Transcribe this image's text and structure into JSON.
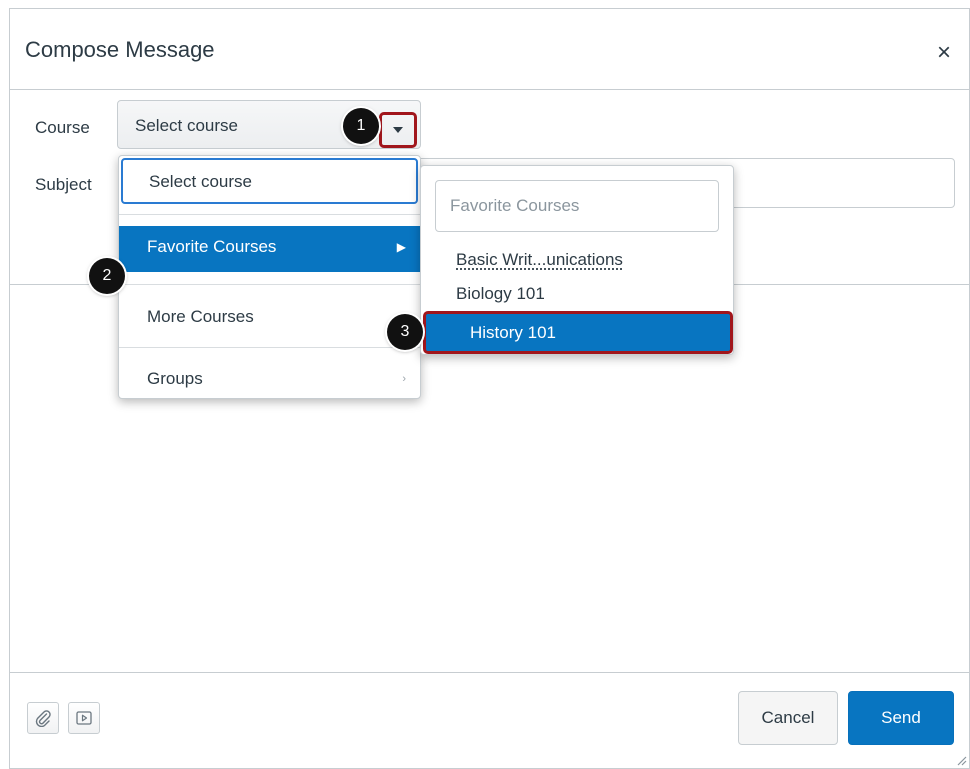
{
  "dialog": {
    "title": "Compose Message",
    "close_glyph": "×"
  },
  "fields": {
    "course_label": "Course",
    "subject_label": "Subject",
    "course_value": "Select course"
  },
  "course_menu": {
    "items": [
      {
        "label": "Select course",
        "has_submenu": false
      },
      {
        "label": "Favorite Courses",
        "has_submenu": true
      },
      {
        "label": "More Courses",
        "has_submenu": true
      },
      {
        "label": "Groups",
        "has_submenu": true
      }
    ],
    "highlighted": "Favorite Courses"
  },
  "favorite_submenu": {
    "filter_placeholder": "Favorite Courses",
    "items": [
      "Basic Writ...unications",
      "Biology 101",
      "History 101"
    ],
    "highlighted": "History 101"
  },
  "callouts": [
    "1",
    "2",
    "3"
  ],
  "footer": {
    "attach_icon": "paperclip-icon",
    "media_icon": "media-play-icon",
    "cancel_label": "Cancel",
    "send_label": "Send"
  },
  "colors": {
    "accent": "#0875c1",
    "highlight_border": "#a1161c",
    "text": "#2d3b45",
    "border": "#c7cdd1"
  }
}
